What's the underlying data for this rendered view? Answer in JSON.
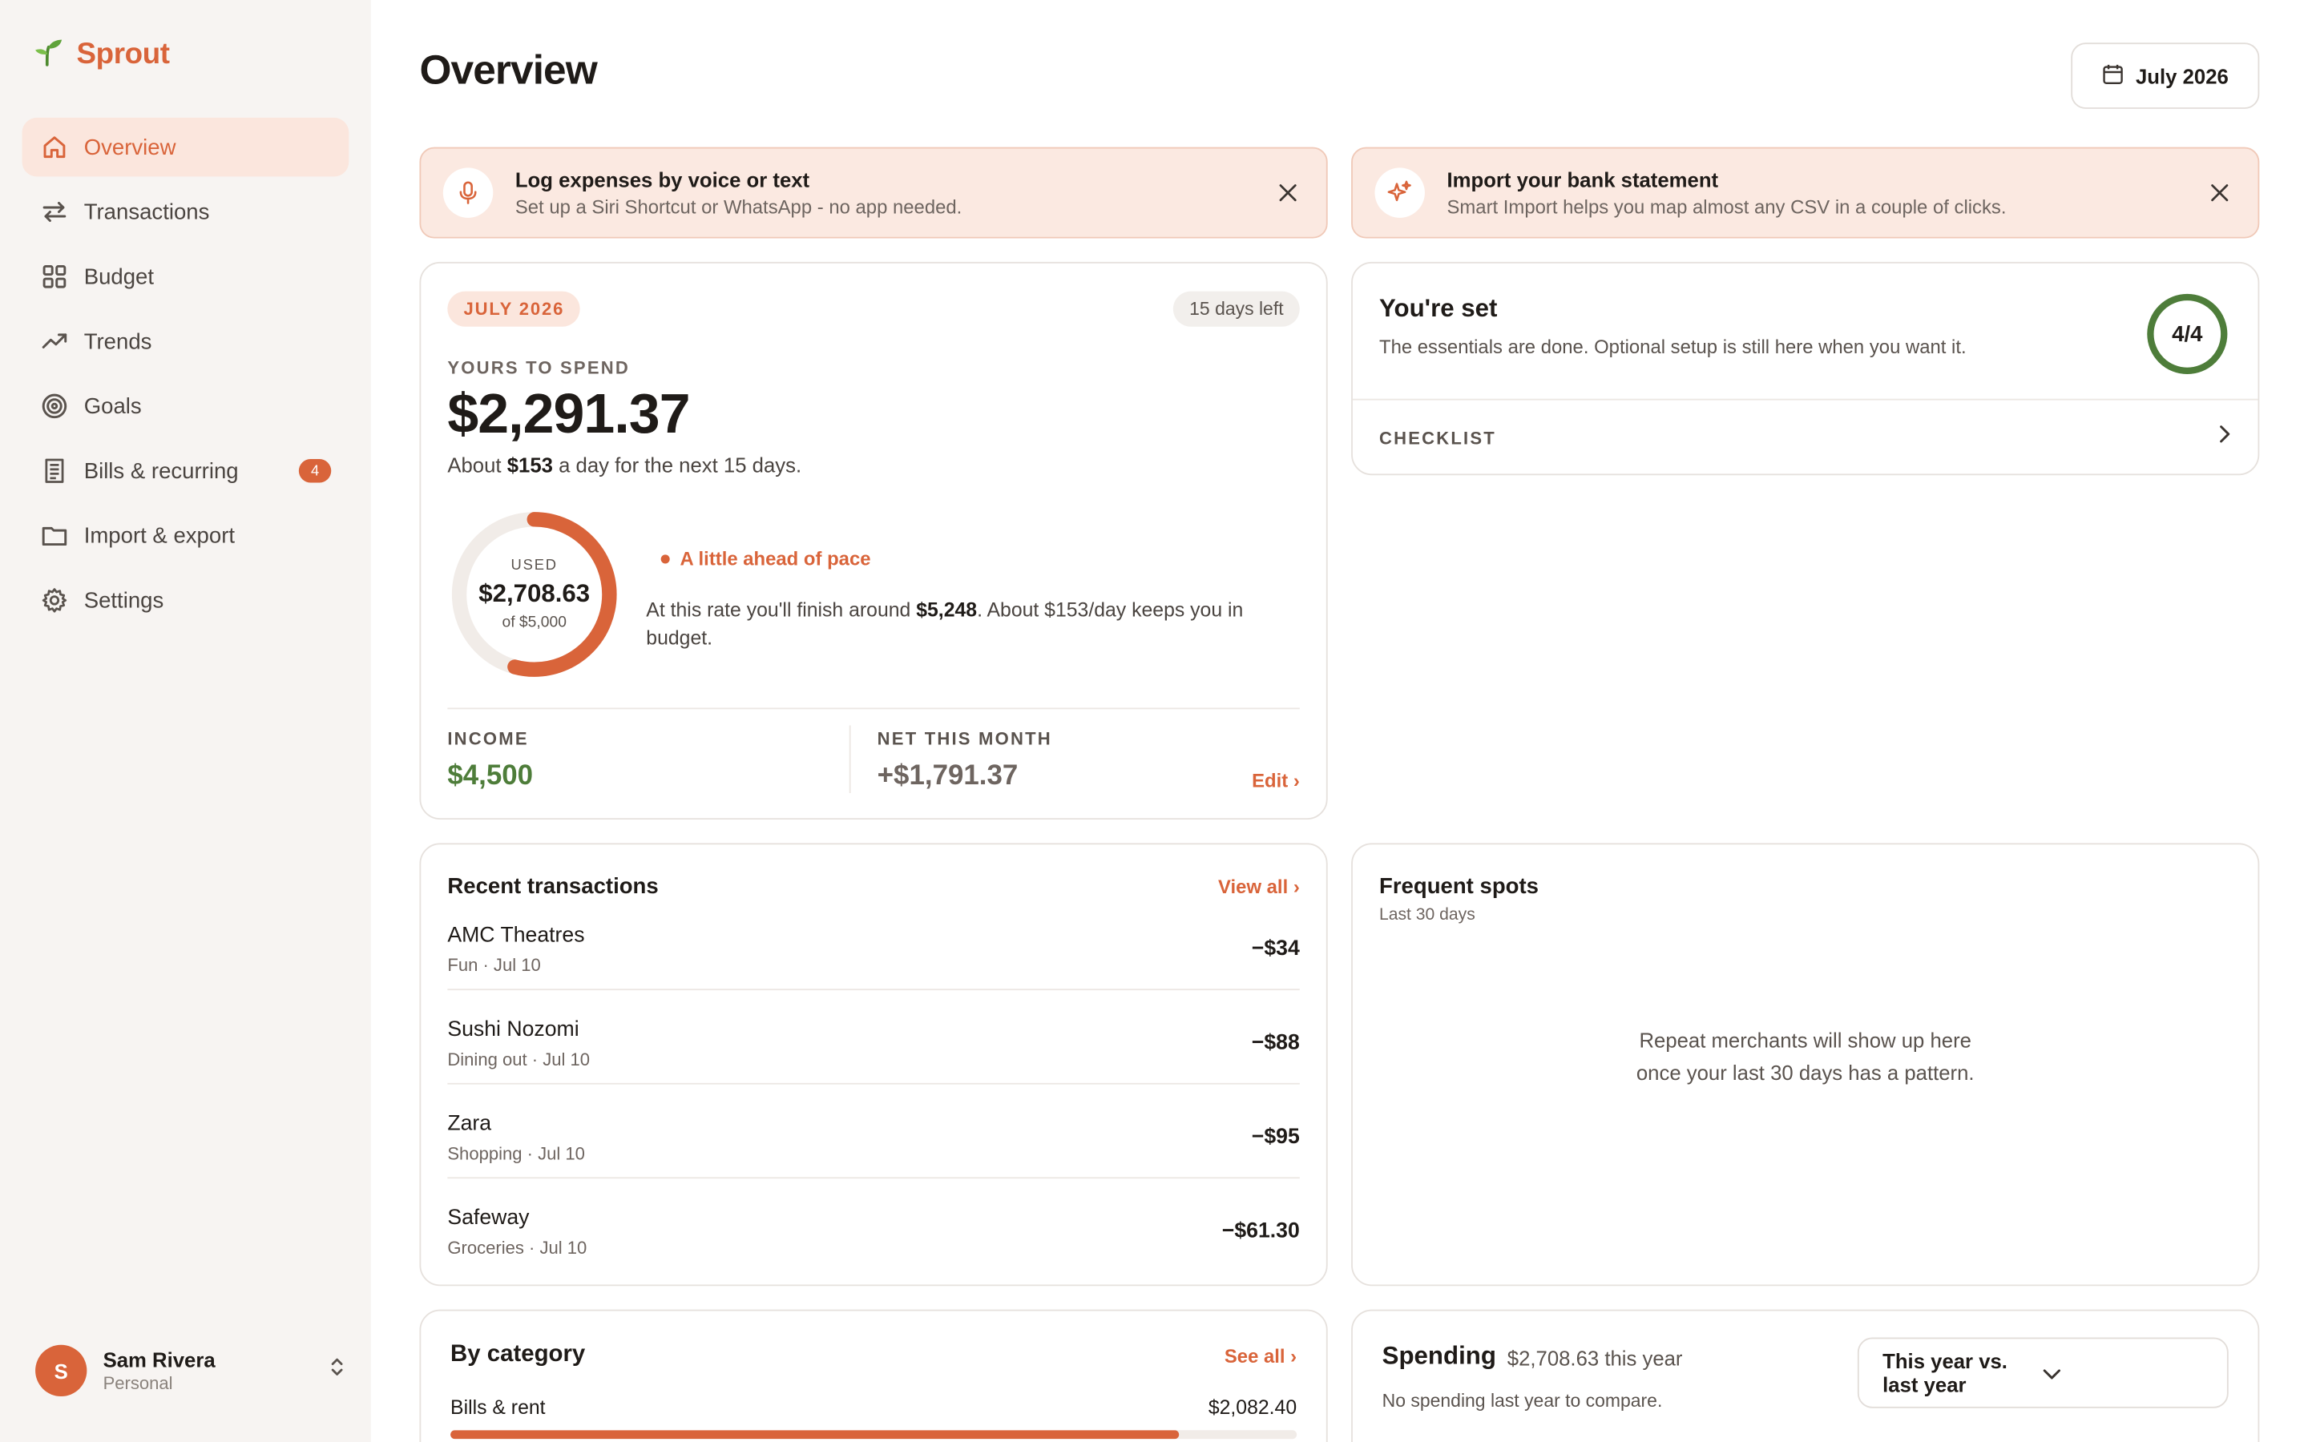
{
  "brand": {
    "name": "Sprout"
  },
  "nav": [
    {
      "label": "Overview",
      "icon": "home-icon",
      "active": true
    },
    {
      "label": "Transactions",
      "icon": "arrows-swap-icon"
    },
    {
      "label": "Budget",
      "icon": "grid-icon"
    },
    {
      "label": "Trends",
      "icon": "trend-up-icon"
    },
    {
      "label": "Goals",
      "icon": "target-icon"
    },
    {
      "label": "Bills & recurring",
      "icon": "receipt-icon",
      "badge": "4"
    },
    {
      "label": "Import & export",
      "icon": "folder-icon"
    },
    {
      "label": "Settings",
      "icon": "gear-icon"
    }
  ],
  "user": {
    "initial": "S",
    "name": "Sam Rivera",
    "role": "Personal"
  },
  "header": {
    "title": "Overview",
    "month_button": "July 2026"
  },
  "banners": [
    {
      "title": "Log expenses by voice or text",
      "subtitle": "Set up a Siri Shortcut or WhatsApp - no app needed."
    },
    {
      "title": "Import your bank statement",
      "subtitle": "Smart Import helps you map almost any CSV in a couple of clicks."
    }
  ],
  "budget": {
    "month_pill": "JULY 2026",
    "days_left": "15 days left",
    "label": "YOURS TO SPEND",
    "amount": "$2,291.37",
    "per_day_prefix": "About ",
    "per_day_amount": "$153",
    "per_day_suffix": " a day for the next 15 days.",
    "used_label": "USED",
    "used_value": "$2,708.63",
    "used_of": "of $5,000",
    "used_fraction": 0.5417,
    "pace_status": "A little ahead of pace",
    "pace_prefix": "At this rate you'll finish around ",
    "pace_amount": "$5,248",
    "pace_suffix": ". About $153/day keeps you in budget.",
    "income_label": "INCOME",
    "income_value": "$4,500",
    "net_label": "NET THIS MONTH",
    "net_value": "+$1,791.37",
    "edit_link": "Edit ›"
  },
  "setup": {
    "title": "You're set",
    "subtitle": "The essentials are done. Optional setup is still here when you want it.",
    "progress": "4/4",
    "progress_fraction": 1.0,
    "checklist_label": "CHECKLIST"
  },
  "transactions": {
    "title": "Recent transactions",
    "view_all": "View all ›",
    "items": [
      {
        "name": "AMC Theatres",
        "meta": "Fun · Jul 10",
        "amount": "−$34"
      },
      {
        "name": "Sushi Nozomi",
        "meta": "Dining out · Jul 10",
        "amount": "−$88"
      },
      {
        "name": "Zara",
        "meta": "Shopping · Jul 10",
        "amount": "−$95"
      },
      {
        "name": "Safeway",
        "meta": "Groceries · Jul 10",
        "amount": "−$61.30"
      }
    ]
  },
  "frequent": {
    "title": "Frequent spots",
    "subtitle": "Last 30 days",
    "empty_line1": "Repeat merchants will show up here",
    "empty_line2": "once your last 30 days has a pattern."
  },
  "category": {
    "title": "By category",
    "see_all": "See all ›",
    "rows": [
      {
        "name": "Bills & rent",
        "amount": "$2,082.40",
        "fraction": 0.86
      }
    ]
  },
  "spending": {
    "title": "Spending",
    "total": "$2,708.63 this year",
    "subtitle": "No spending last year to compare.",
    "select_value": "This year vs. last year"
  },
  "colors": {
    "accent": "#d9643a",
    "positive": "#4e7d3a",
    "banner_bg": "#fbe9e1",
    "ring_green": "#4e7d3a"
  }
}
